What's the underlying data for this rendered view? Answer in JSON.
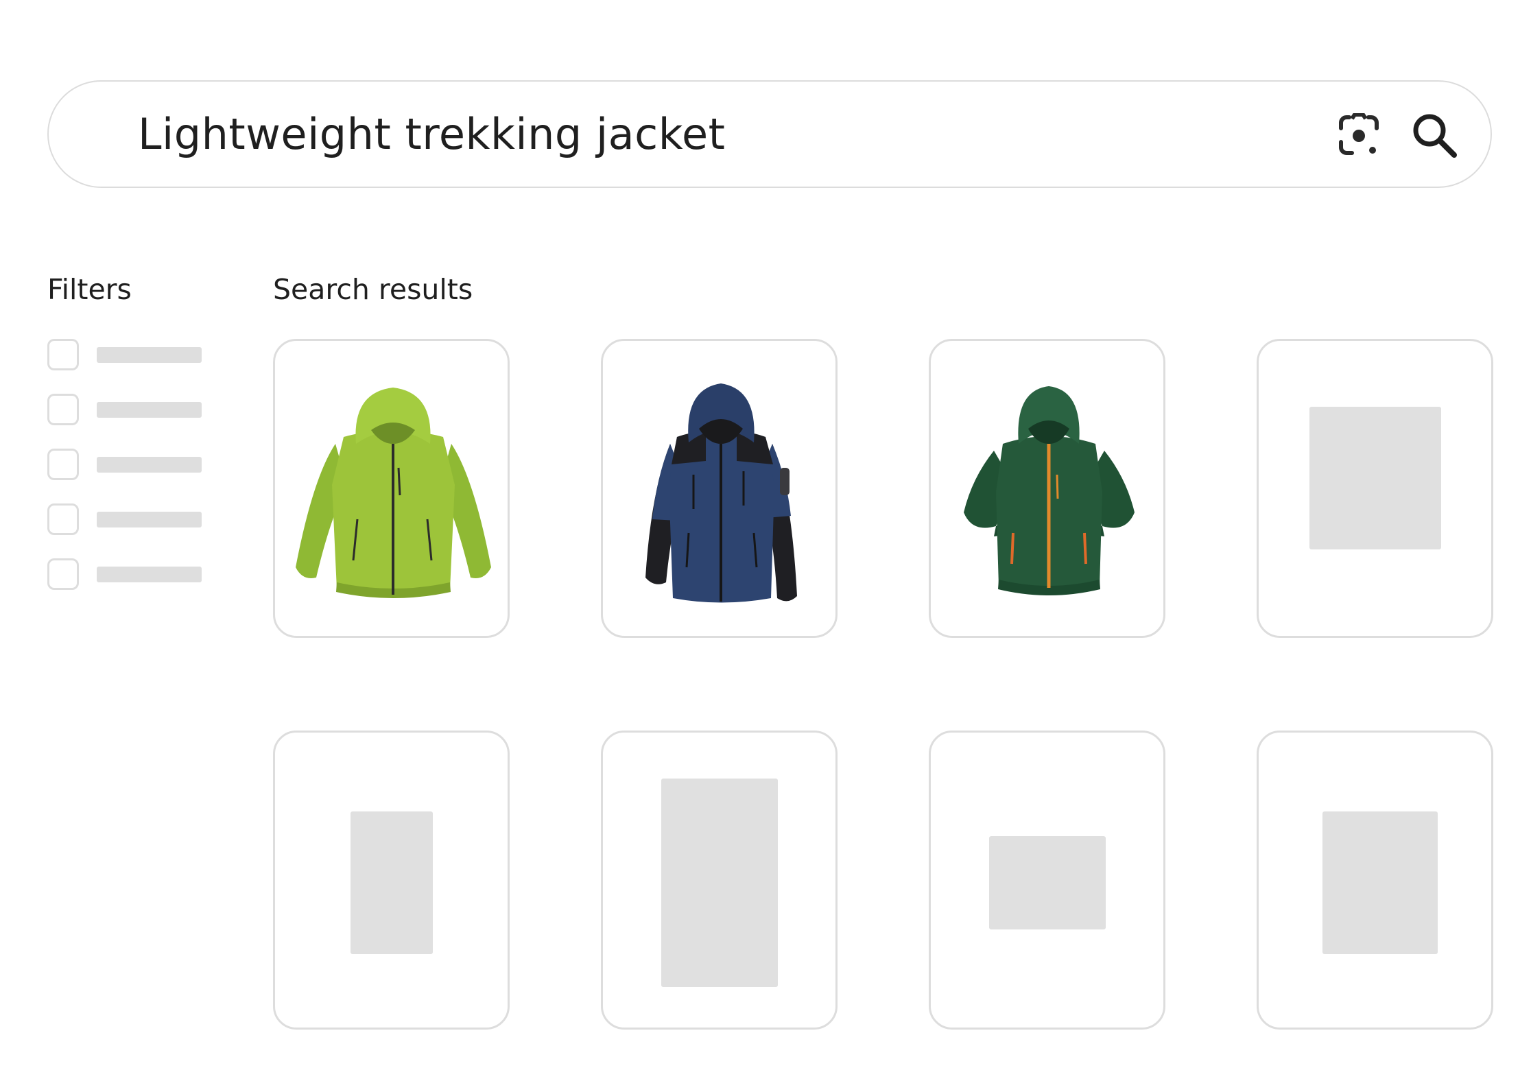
{
  "search": {
    "query": "Lightweight trekking jacket",
    "lens_icon": "camera-lens-icon",
    "search_icon": "search-icon"
  },
  "filters": {
    "heading": "Filters",
    "items": [
      {
        "checked": false
      },
      {
        "checked": false
      },
      {
        "checked": false
      },
      {
        "checked": false
      },
      {
        "checked": false
      }
    ]
  },
  "results": {
    "heading": "Search results",
    "items": [
      {
        "kind": "jacket",
        "color": "#9dc43a",
        "accent": "#2b2b2b",
        "description": "lime green hooded rain jacket"
      },
      {
        "kind": "jacket",
        "color": "#2d4470",
        "accent": "#1b1b1b",
        "description": "navy blue hooded softshell jacket"
      },
      {
        "kind": "jacket",
        "color": "#25593a",
        "accent": "#e38a2c",
        "description": "dark green hooded softshell jacket"
      },
      {
        "kind": "placeholder"
      },
      {
        "kind": "placeholder"
      },
      {
        "kind": "placeholder"
      },
      {
        "kind": "placeholder"
      },
      {
        "kind": "placeholder"
      }
    ]
  },
  "colors": {
    "border": "#dddddd",
    "placeholder": "#e0e0e0",
    "text": "#1f1f1f"
  }
}
